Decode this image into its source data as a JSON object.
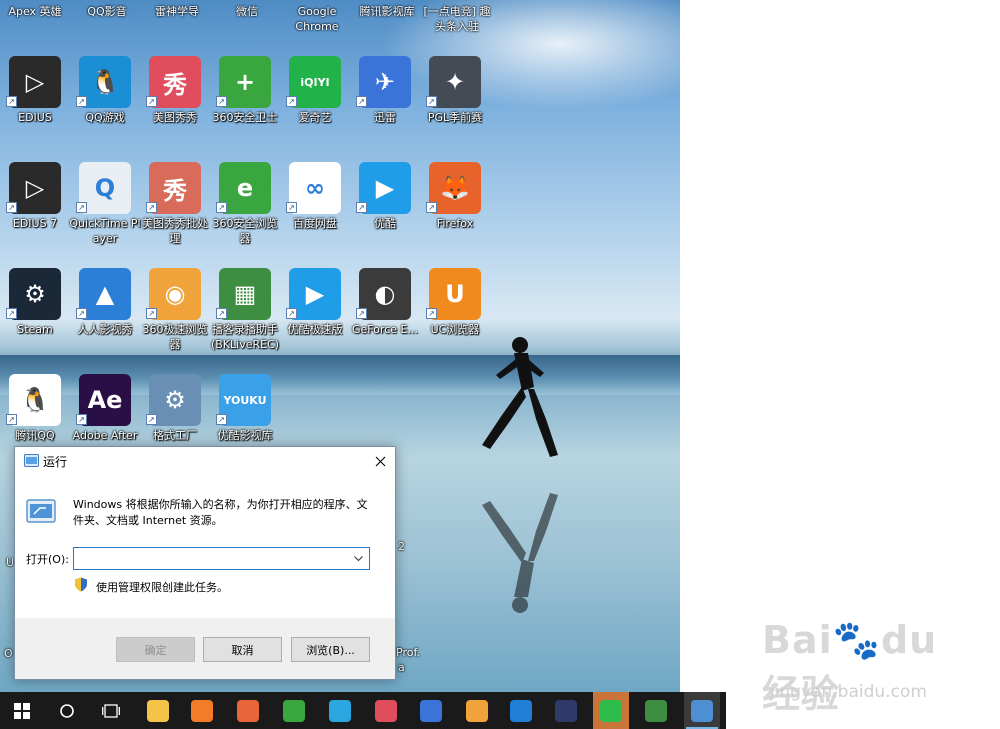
{
  "desktop": {
    "top_row_labels": [
      "Apex 英雄",
      "QQ影音",
      "雷神学导",
      "微信",
      "Google Chrome",
      "腾讯影视库",
      "[一点电竞] 趣头条入驻"
    ],
    "icons": [
      {
        "label": "EDIUS",
        "color": "#2a2a2a",
        "glyph": "▷",
        "icon": "edius-icon"
      },
      {
        "label": "QQ游戏",
        "color": "#1b8fd6",
        "glyph": "🐧",
        "icon": "qq-game-icon"
      },
      {
        "label": "美图秀秀",
        "color": "#e04d5c",
        "glyph": "秀",
        "icon": "meitu-icon"
      },
      {
        "label": "360安全卫士",
        "color": "#3aa63f",
        "glyph": "+",
        "icon": "360-safe-icon"
      },
      {
        "label": "爱奇艺",
        "color": "#21b24a",
        "glyph": "iQIYI",
        "icon": "iqiyi-icon"
      },
      {
        "label": "迅雷",
        "color": "#3b74d9",
        "glyph": "✈",
        "icon": "xunlei-icon"
      },
      {
        "label": "PGL季前赛",
        "color": "#444b55",
        "glyph": "✦",
        "icon": "pgl-icon"
      },
      {
        "label": "EDIUS 7",
        "color": "#2a2a2a",
        "glyph": "▷",
        "icon": "edius7-icon"
      },
      {
        "label": "QuickTime Player",
        "color": "#e9eef4",
        "glyph": "Q",
        "icon": "quicktime-icon"
      },
      {
        "label": "美图秀秀批处理",
        "color": "#d96b5a",
        "glyph": "秀",
        "icon": "meitu-batch-icon"
      },
      {
        "label": "360安全浏览器",
        "color": "#3aa63f",
        "glyph": "e",
        "icon": "360-browser-icon"
      },
      {
        "label": "百度网盘",
        "color": "#ffffff",
        "glyph": "∞",
        "icon": "baidu-netdisk-icon"
      },
      {
        "label": "优酷",
        "color": "#1f9de9",
        "glyph": "▶",
        "icon": "youku-icon"
      },
      {
        "label": "Firefox",
        "color": "#e8632b",
        "glyph": "🦊",
        "icon": "firefox-icon"
      },
      {
        "label": "Steam",
        "color": "#1b2838",
        "glyph": "⚙",
        "icon": "steam-icon"
      },
      {
        "label": "人人影视秀",
        "color": "#2c7fd6",
        "glyph": "▲",
        "icon": "renren-icon"
      },
      {
        "label": "360极速浏览器",
        "color": "#f0a23b",
        "glyph": "◉",
        "icon": "360-speed-icon"
      },
      {
        "label": "播客录播助手(BKLiveREC)",
        "color": "#3e8e41",
        "glyph": "▦",
        "icon": "bklive-icon"
      },
      {
        "label": "优酷极速版",
        "color": "#1f9de9",
        "glyph": "▶",
        "icon": "youku-exp-icon"
      },
      {
        "label": "GeForce E...",
        "color": "#3b3b3b",
        "glyph": "◐",
        "icon": "geforce-icon"
      },
      {
        "label": "UC浏览器",
        "color": "#f08a1c",
        "glyph": "U",
        "icon": "uc-icon"
      },
      {
        "label": "腾讯QQ",
        "color": "#ffffff",
        "glyph": "🐧",
        "icon": "qq-icon"
      },
      {
        "label": "Adobe After",
        "color": "#2a0f46",
        "glyph": "Ae",
        "icon": "after-effects-icon"
      },
      {
        "label": "格式工厂",
        "color": "#6a8fb5",
        "glyph": "⚙",
        "icon": "format-factory-icon"
      },
      {
        "label": "优酷影视库",
        "color": "#3aa0e8",
        "glyph": "YOUKU",
        "icon": "youku-lib-icon"
      }
    ],
    "partial_labels": [
      "U",
      "O",
      "2",
      "Prof.",
      "a"
    ]
  },
  "run_dialog": {
    "title": "运行",
    "description": "Windows 将根据你所输入的名称，为你打开相应的程序、文件夹、文档或 Internet 资源。",
    "open_label": "打开(O):",
    "open_value": "",
    "admin_note": "使用管理权限创建此任务。",
    "ok_label": "确定",
    "cancel_label": "取消",
    "browse_label": "浏览(B)..."
  },
  "taskbar": {
    "items": [
      {
        "icon": "start-icon"
      },
      {
        "icon": "search-circle-icon"
      },
      {
        "icon": "task-view-icon"
      },
      {
        "icon": "file-explorer-icon",
        "color": "#f4c449"
      },
      {
        "icon": "flash-app-icon",
        "color": "#f37c2a"
      },
      {
        "icon": "360-speed-icon",
        "color": "#e8653a"
      },
      {
        "icon": "360-browser-icon",
        "color": "#3aa63f"
      },
      {
        "icon": "game-app-icon",
        "color": "#2aa7e0"
      },
      {
        "icon": "meitu-icon",
        "color": "#e04d5c"
      },
      {
        "icon": "xunlei-icon",
        "color": "#3b74d9"
      },
      {
        "icon": "window-app-icon",
        "color": "#f0a23b"
      },
      {
        "icon": "sogou-icon",
        "color": "#1f7fd6"
      },
      {
        "icon": "rocket-app-icon",
        "color": "#303a6a"
      },
      {
        "icon": "wechat-icon",
        "color": "#2ebd4a"
      },
      {
        "icon": "bklive-icon",
        "color": "#3e8e41"
      },
      {
        "icon": "run-app-icon",
        "color": "#4d8fd1"
      }
    ]
  },
  "watermark": {
    "logo": "Bai🐾du经验",
    "url": "jingyan.baidu.com"
  }
}
